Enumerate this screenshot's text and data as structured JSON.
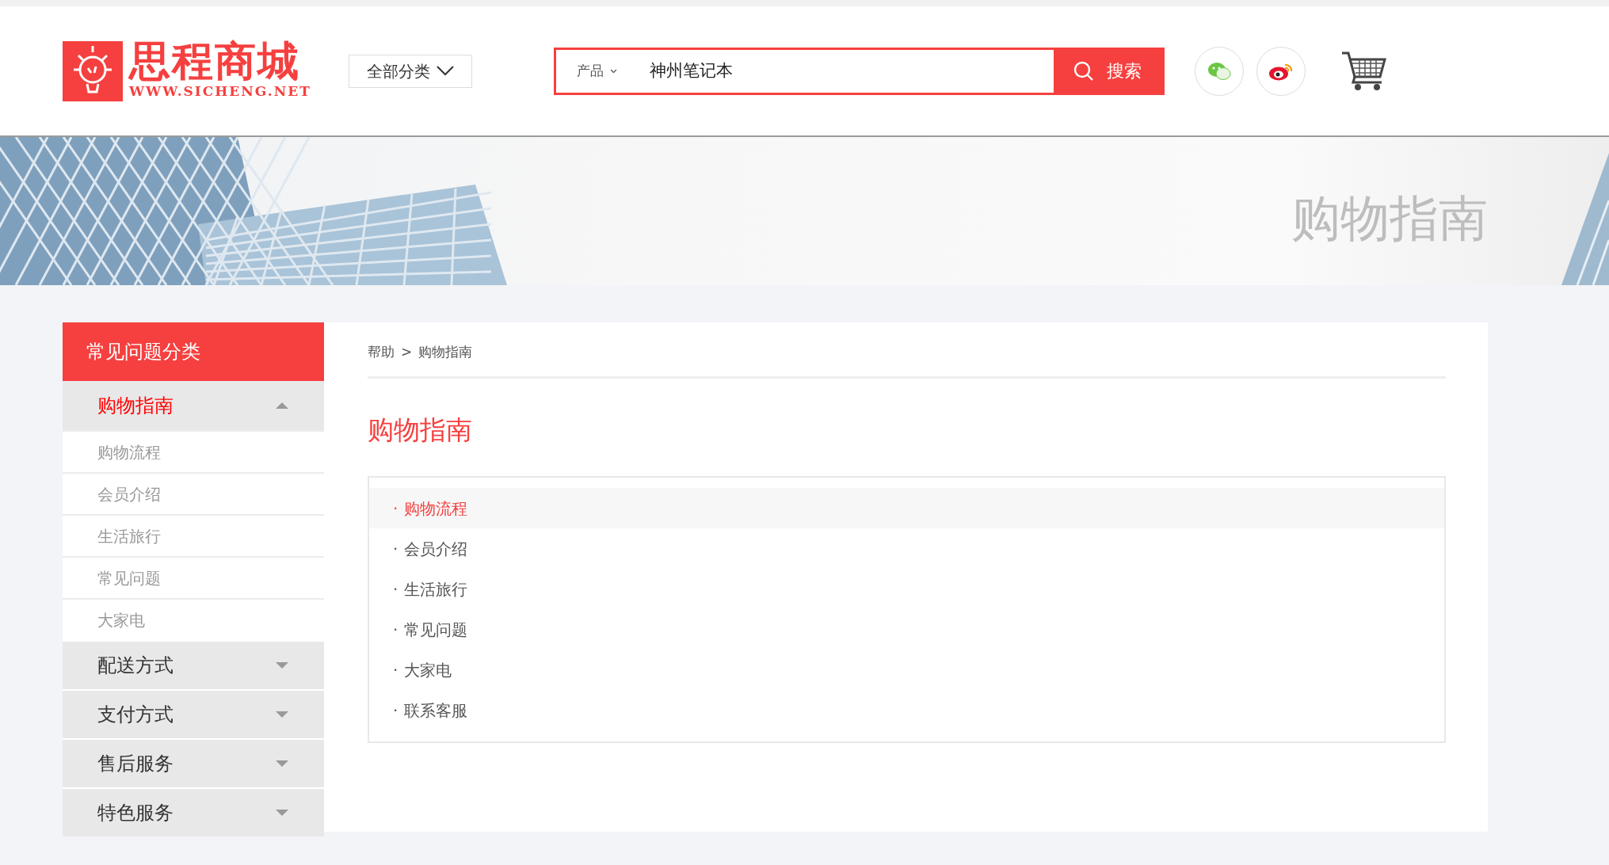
{
  "header": {
    "logo": {
      "name": "思程商城",
      "url": "WWW.SICHENG.NET"
    },
    "category_dropdown": {
      "label": "全部分类"
    },
    "search": {
      "scope": "产品",
      "value": "神州笔记本",
      "button": "搜索"
    }
  },
  "banner": {
    "title": "购物指南"
  },
  "sidebar": {
    "title": "常见问题分类",
    "groups": [
      {
        "label": "购物指南",
        "expanded": true,
        "selected": true,
        "children": [
          {
            "label": "购物流程"
          },
          {
            "label": "会员介绍"
          },
          {
            "label": "生活旅行"
          },
          {
            "label": "常见问题"
          },
          {
            "label": "大家电"
          }
        ]
      },
      {
        "label": "配送方式",
        "expanded": false,
        "selected": false
      },
      {
        "label": "支付方式",
        "expanded": false,
        "selected": false
      },
      {
        "label": "售后服务",
        "expanded": false,
        "selected": false
      },
      {
        "label": "特色服务",
        "expanded": false,
        "selected": false
      }
    ]
  },
  "content": {
    "breadcrumb": [
      "帮助",
      "购物指南"
    ],
    "breadcrumb_separator": ">",
    "title": "购物指南",
    "bullet": "·",
    "items": [
      {
        "label": "购物流程",
        "selected": true
      },
      {
        "label": "会员介绍",
        "selected": false
      },
      {
        "label": "生活旅行",
        "selected": false
      },
      {
        "label": "常见问题",
        "selected": false
      },
      {
        "label": "大家电",
        "selected": false
      },
      {
        "label": "联系客服",
        "selected": false
      }
    ]
  }
}
